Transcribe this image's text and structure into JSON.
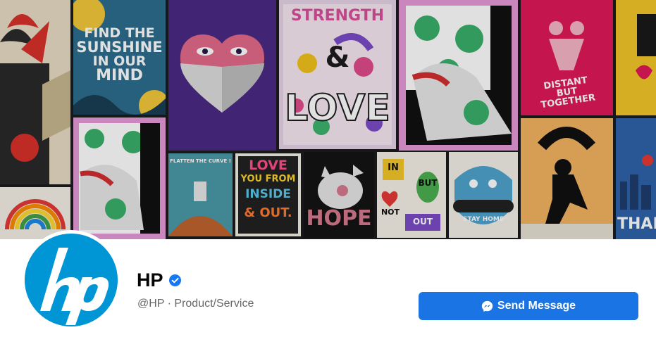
{
  "cover": {
    "posters": [
      {
        "id": "find-sunshine",
        "lines": [
          "FIND THE",
          "SUNSHINE",
          "IN OUR",
          "MIND"
        ]
      },
      {
        "id": "strength-love",
        "lines": [
          "STRENGTH",
          "&",
          "LOVE"
        ]
      },
      {
        "id": "distant-together",
        "lines": [
          "DISTANT",
          "BUT",
          "TOGETHER"
        ]
      },
      {
        "id": "flatten-curve",
        "lines": [
          "FLATTEN THE CURVE !"
        ]
      },
      {
        "id": "love-you",
        "lines": [
          "LOVE",
          "YOU FROM",
          "INSIDE",
          "& OUT."
        ]
      },
      {
        "id": "hope",
        "lines": [
          "HOPE"
        ]
      },
      {
        "id": "in-but-not-out",
        "lines": [
          "IN",
          "BUT",
          "NOT",
          "OUT"
        ]
      },
      {
        "id": "stay-home",
        "lines": [
          "STAY HOME"
        ]
      },
      {
        "id": "thank",
        "lines": [
          "THAN"
        ]
      }
    ]
  },
  "page": {
    "name": "HP",
    "handle_category": "@HP · Product/Service",
    "logo_text": "hp"
  },
  "actions": {
    "send_message": "Send Message"
  },
  "colors": {
    "brand_blue": "#0096d6",
    "button_blue": "#1b74e4",
    "verified_blue": "#1877f2",
    "text_primary": "#050505",
    "text_secondary": "#65676b"
  }
}
